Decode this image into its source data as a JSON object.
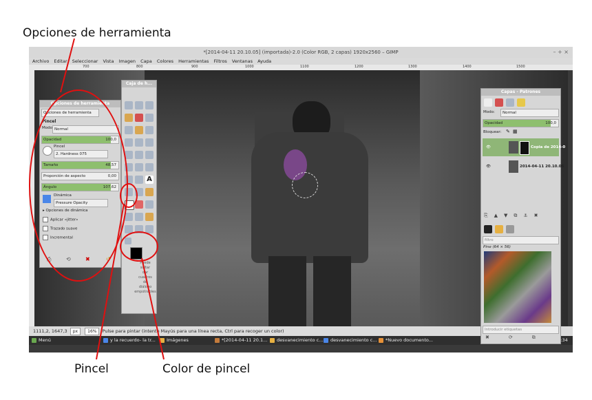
{
  "annotations": {
    "tool_options": "Opciones de herramienta",
    "brush": "Pincel",
    "brush_color": "Color de pincel"
  },
  "accent_color": "#e01010",
  "window": {
    "title": "*[2014-04-11 20.10.05] (importada)-2.0 (Color RGB, 2 capas) 1920x2560 – GIMP",
    "controls": "– + ×"
  },
  "menu": [
    "Archivo",
    "Editar",
    "Seleccionar",
    "Vista",
    "Imagen",
    "Capa",
    "Colores",
    "Herramientas",
    "Filtros",
    "Ventanas",
    "Ayuda"
  ],
  "ruler_ticks": [
    "700",
    "800",
    "900",
    "1000",
    "1100",
    "1200",
    "1300",
    "1400",
    "1500"
  ],
  "tool_options": {
    "dock_title": "Opciones de herramienta",
    "tab_label": "Opciones de herramienta",
    "tool_name": "Pincel",
    "mode_label": "Modo:",
    "mode_value": "Normal",
    "opacity_label": "Opacidad",
    "opacity_value": "100,0",
    "brush_label": "Pincel",
    "brush_value": "2. Hardness 075",
    "size_label": "Tamaño",
    "size_value": "48,57",
    "aspect_label": "Proporción de aspecto",
    "aspect_value": "0,00",
    "angle_label": "Ángulo",
    "angle_value": "107,62",
    "dynamics_label": "Dinámica",
    "dynamics_value": "Pressure Opacity",
    "dynamics_options": "Opciones de dinámica",
    "jitter": "Aplicar «jitter»",
    "smooth": "Trazado suave",
    "incremental": "Incremental"
  },
  "toolbox": {
    "title": "Caja de h...",
    "drop_hint": [
      "Puede",
      "soltar",
      "dar",
      "cuadros",
      "de",
      "diálogo",
      "empotrables"
    ]
  },
  "layers": {
    "title": "Capas - Patrones",
    "mode_label": "Modo:",
    "mode_value": "Normal",
    "opacity_label": "Opacidad",
    "opacity_value": "100,0",
    "lock_label": "Bloquear:",
    "layer_items": [
      "Copia de 2014-0",
      "2014-04-11 20.10.05"
    ],
    "filter_placeholder": "filtro",
    "pattern_name": "Pine (64 × 56)",
    "tags_placeholder": "Introducir etiquetas"
  },
  "status": {
    "coords": "1111,2, 1647,3",
    "unit": "px",
    "zoom": "16%",
    "message": "Pulse para pintar (intente Mayús para una línea recta, Ctrl para recoger un color)"
  },
  "taskbar": {
    "menu": "Menú",
    "tasks": [
      "y la recuerdo- la tr...",
      "Imágenes",
      "*[2014-04-11 20.1...",
      "desvanecimiento c...",
      "desvanecimiento c...",
      "*Nuevo documento..."
    ],
    "workspaces": [
      "1",
      "2"
    ],
    "clock": "21:34"
  }
}
